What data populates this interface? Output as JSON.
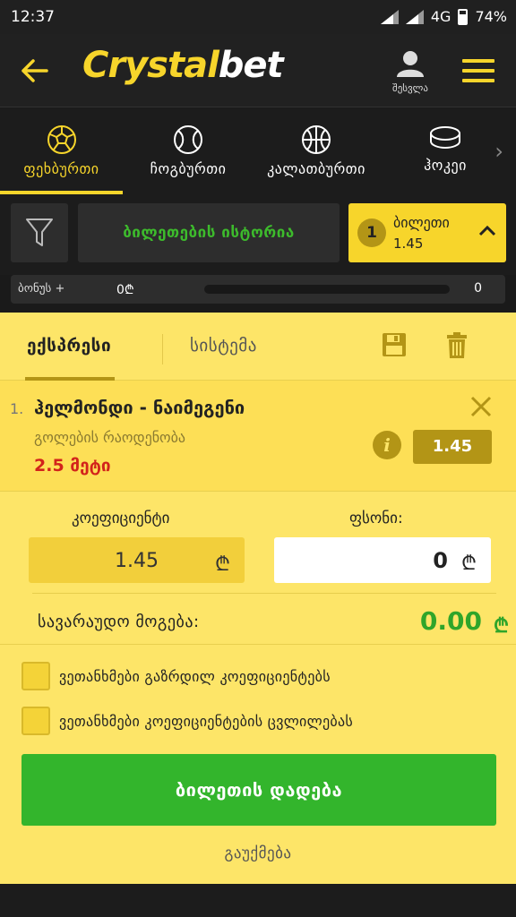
{
  "status_bar": {
    "time": "12:37",
    "network": "4G",
    "battery": "74%"
  },
  "header": {
    "logo_part1": "Crystal",
    "logo_part2": "bet",
    "account_label": "შესვლა",
    "brand_color": "#f7d52b"
  },
  "sports": [
    {
      "label": "ფეხბურთი",
      "icon": "soccer-ball-icon",
      "active": true
    },
    {
      "label": "ჩოგბურთი",
      "icon": "tennis-ball-icon",
      "active": false
    },
    {
      "label": "კალათბურთი",
      "icon": "basketball-icon",
      "active": false
    },
    {
      "label": "ჰოკეი",
      "icon": "hockey-puck-icon",
      "active": false
    }
  ],
  "toolbar": {
    "history_label": "ბილეთების ისტორია",
    "ticket_count": "1",
    "ticket_label": "ბილეთი",
    "ticket_odds": "1.45"
  },
  "bonus": {
    "label": "ბონუს +",
    "amount": "0₾",
    "progress": 0,
    "value": "0"
  },
  "slip": {
    "tab_express": "ექსპრესი",
    "tab_system": "სისტემა",
    "bet": {
      "index": "1.",
      "match": "ჰელმონდი - ნაიმეგენი",
      "market": "გოლების რაოდენობა",
      "pick": "2.5 მეტი",
      "odds": "1.45"
    },
    "coef_label": "კოეფიციენტი",
    "coef_value": "1.45",
    "stake_label": "ფსონი:",
    "stake_value": "0",
    "currency": "₾",
    "win_label": "სავარაუდო მოგება:",
    "win_value": "0.00",
    "option1": "ვეთანხმები გაზრდილ კოეფიციენტებს",
    "option2": "ვეთანხმები კოეფიციენტების ცვლილებას",
    "place_label": "ბილეთის დადება",
    "cancel_label": "გაუქმება"
  }
}
